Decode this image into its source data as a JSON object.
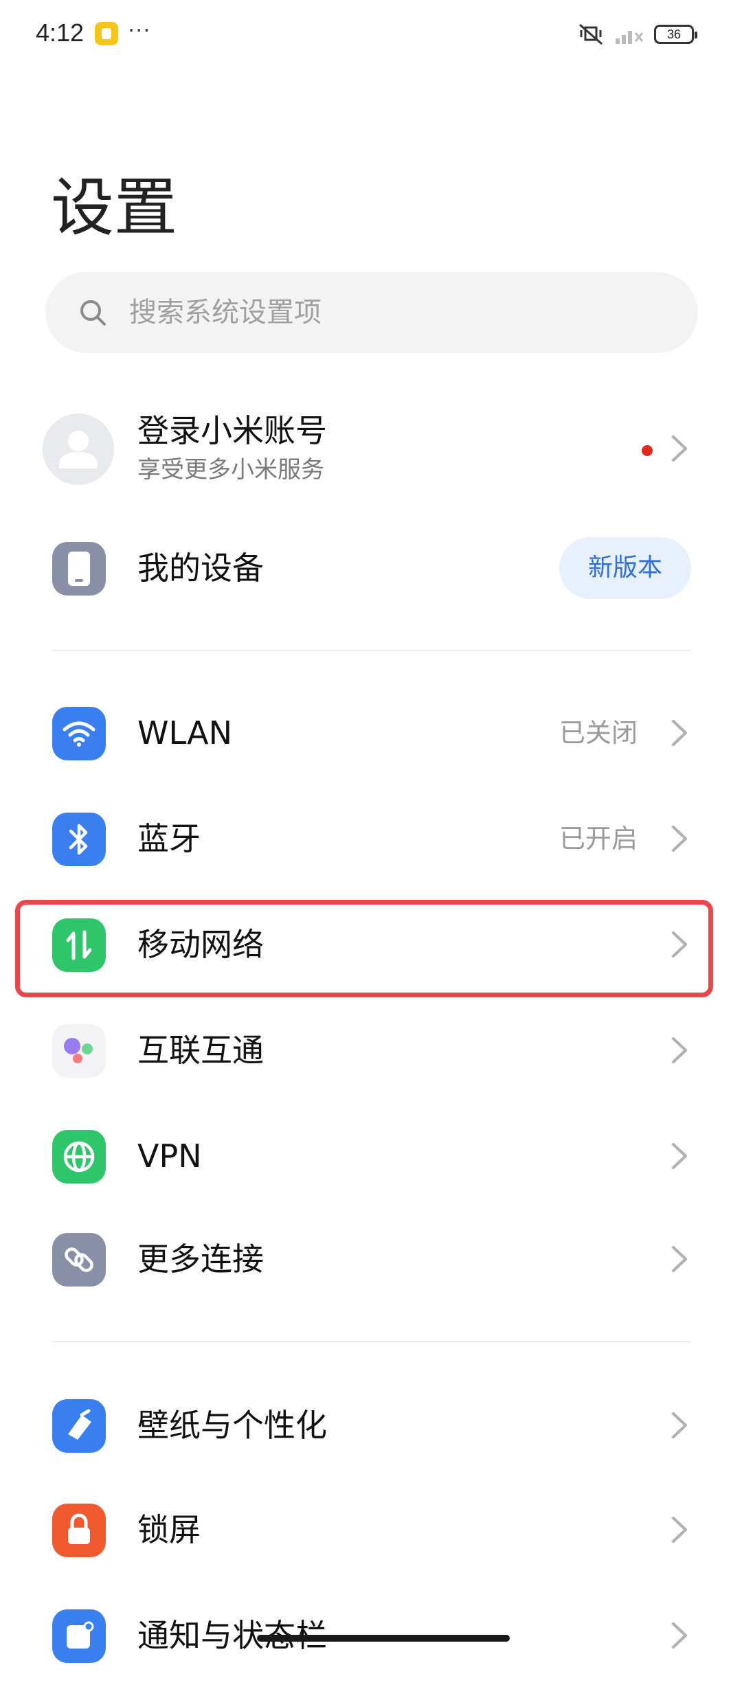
{
  "status_bar": {
    "time": "4:12",
    "more": "···",
    "battery": "36"
  },
  "page": {
    "title": "设置"
  },
  "search": {
    "placeholder": "搜索系统设置项"
  },
  "account": {
    "title": "登录小米账号",
    "subtitle": "享受更多小米服务"
  },
  "my_device": {
    "label": "我的设备",
    "badge": "新版本"
  },
  "connectivity": [
    {
      "label": "WLAN",
      "value": "已关闭",
      "icon": "wifi-icon",
      "color": "#3a7ff0"
    },
    {
      "label": "蓝牙",
      "value": "已开启",
      "icon": "bluetooth-icon",
      "color": "#3a7ff0"
    },
    {
      "label": "移动网络",
      "value": "",
      "icon": "mobile-data-icon",
      "color": "#2fc56a"
    },
    {
      "label": "互联互通",
      "value": "",
      "icon": "interconnect-icon",
      "color": "#f3f3f5"
    },
    {
      "label": "VPN",
      "value": "",
      "icon": "globe-icon",
      "color": "#2fc56a"
    },
    {
      "label": "更多连接",
      "value": "",
      "icon": "link-icon",
      "color": "#8a8fa8"
    }
  ],
  "personal": [
    {
      "label": "壁纸与个性化",
      "icon": "brush-icon",
      "color": "#3a7ff0"
    },
    {
      "label": "锁屏",
      "icon": "lock-icon",
      "color": "#f0592e"
    },
    {
      "label": "通知与状态栏",
      "icon": "notification-icon",
      "color": "#3a7ff0"
    }
  ],
  "colors": {
    "accent_blue": "#3a7ff0",
    "accent_green": "#2fc56a",
    "highlight_red": "#e8484b"
  }
}
